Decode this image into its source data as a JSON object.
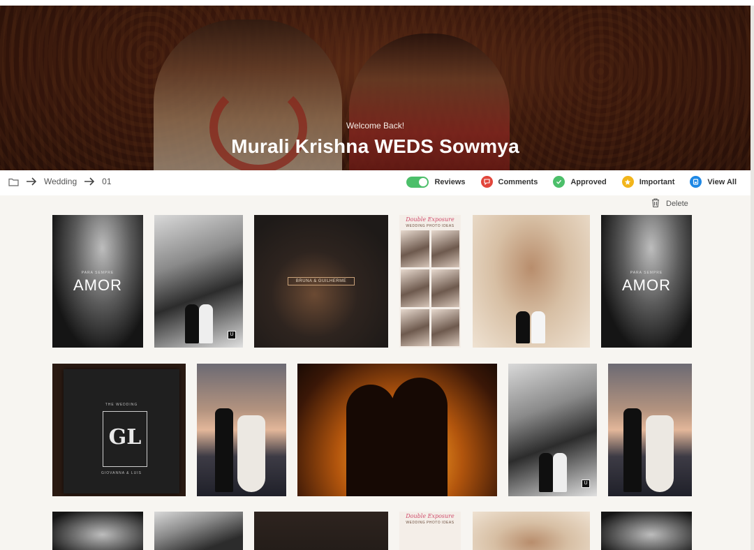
{
  "hero": {
    "welcome": "Welcome Back!",
    "title": "Murali Krishna WEDS Sowmya"
  },
  "breadcrumb": {
    "items": [
      "Wedding",
      "01"
    ]
  },
  "filters": {
    "reviews": "Reviews",
    "comments": "Comments",
    "approved": "Approved",
    "important": "Important",
    "view_all": "View All",
    "reviews_toggle_on": true
  },
  "actions": {
    "delete": "Delete"
  },
  "gallery": {
    "amor_title": "AMOR",
    "amor_sub": "PARA SEMPRE",
    "bruna_caption": "BRUNA & GUILHERME",
    "double_exposure_title": "Double Exposure",
    "double_exposure_sub": "WEDDING PHOTO IDEAS",
    "book_top": "THE WEDDING",
    "book_monogram": "GL",
    "book_bottom": "GIOVANNA & LUIS"
  },
  "colors": {
    "toggle": "#4cbf6a",
    "comments": "#e2463b",
    "approved": "#4cbf6a",
    "important": "#f2b51b",
    "view_all": "#1e88e5"
  }
}
